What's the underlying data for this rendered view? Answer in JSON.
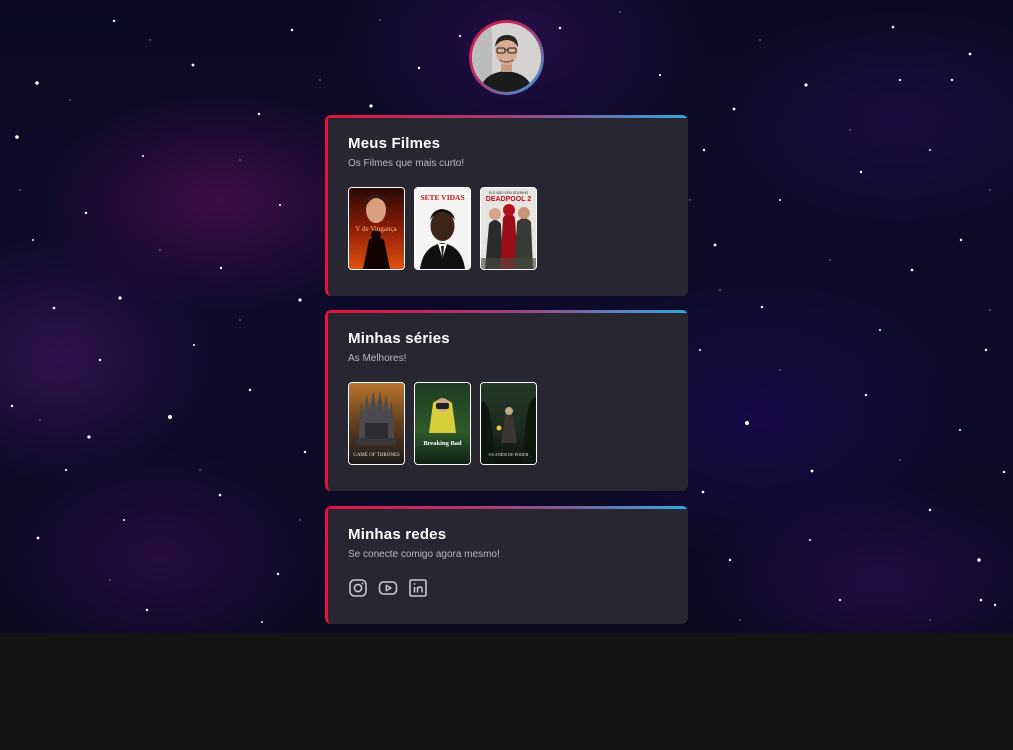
{
  "profile": {
    "avatar_icon": "profile-photo"
  },
  "movies": {
    "title": "Meus Filmes",
    "subtitle": "Os Filmes que mais curto!",
    "posters": [
      {
        "caption": "V de Vingança"
      },
      {
        "caption": "SETE VIDAS"
      },
      {
        "tagline": "ELE NÃO VEM SOZINHO",
        "caption": "DEADPOOL 2"
      }
    ]
  },
  "series": {
    "title": "Minhas séries",
    "subtitle": "As Melhores!",
    "posters": [
      {
        "caption": "GAME OF THRONES"
      },
      {
        "caption": "Breaking Bad"
      },
      {
        "caption": "OS ANÉIS DE PODER"
      }
    ]
  },
  "socials": {
    "title": "Minhas redes",
    "subtitle": "Se conecte comigo agora mesmo!",
    "icons": [
      "instagram-icon",
      "youtube-icon",
      "linkedin-icon"
    ]
  },
  "colors": {
    "accent_red": "#e3133d",
    "accent_blue": "#2fa8e0",
    "card_bg": "#282631"
  }
}
